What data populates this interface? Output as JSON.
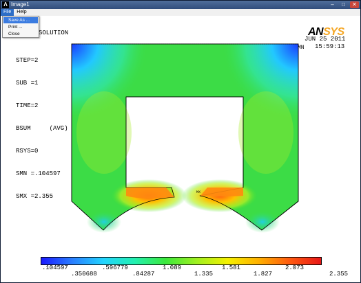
{
  "window": {
    "title": "Image1"
  },
  "menubar": {
    "items": [
      "File",
      "Help"
    ]
  },
  "file_menu": {
    "items": [
      "Save As ...",
      "Print ...",
      "Close"
    ]
  },
  "plot": {
    "header": "SOLUTION",
    "info_lines": [
      "STEP=2",
      "SUB =1",
      "TIME=2",
      "BSUM     (AVG)",
      "RSYS=0",
      "SMN =.104597",
      "SMX =2.355"
    ],
    "logo_part1": "AN",
    "logo_part2": "SYS",
    "date": "JUN 25 2011",
    "time": "15:59:13",
    "mn_label": "MN",
    "mx_label": "MX"
  },
  "legend": {
    "top_values": [
      ".104597",
      ".596779",
      "1.089",
      "1.581",
      "2.073"
    ],
    "bottom_values": [
      ".350688",
      ".84287",
      "1.335",
      "1.827",
      "2.355"
    ],
    "colors": [
      "#1a1aff",
      "#22d4ff",
      "#3ce83c",
      "#f5f000",
      "#e81818"
    ]
  }
}
